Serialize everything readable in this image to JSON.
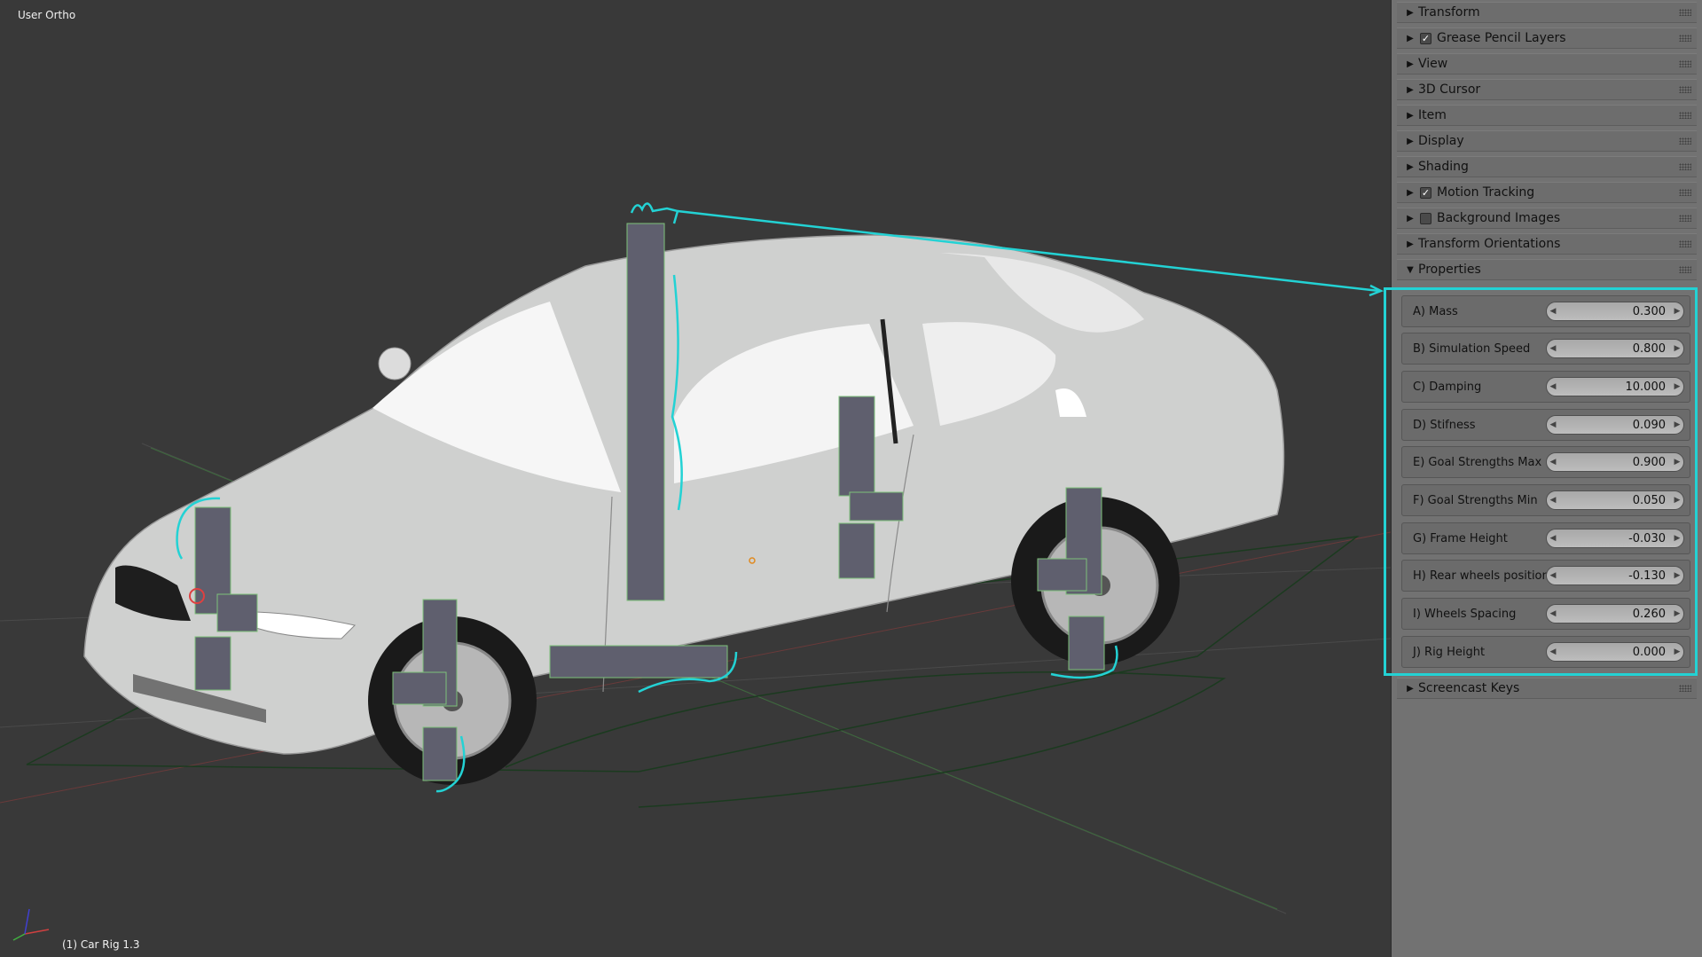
{
  "viewport": {
    "view_label": "User Ortho",
    "object_label": "(1) Car Rig 1.3"
  },
  "sidebar": {
    "panels": [
      {
        "label": "Transform",
        "expanded": false,
        "checkbox": null
      },
      {
        "label": "Grease Pencil Layers",
        "expanded": false,
        "checkbox": true
      },
      {
        "label": "View",
        "expanded": false,
        "checkbox": null
      },
      {
        "label": "3D Cursor",
        "expanded": false,
        "checkbox": null
      },
      {
        "label": "Item",
        "expanded": false,
        "checkbox": null
      },
      {
        "label": "Display",
        "expanded": false,
        "checkbox": null
      },
      {
        "label": "Shading",
        "expanded": false,
        "checkbox": null
      },
      {
        "label": "Motion Tracking",
        "expanded": false,
        "checkbox": true
      },
      {
        "label": "Background Images",
        "expanded": false,
        "checkbox": false
      },
      {
        "label": "Transform Orientations",
        "expanded": false,
        "checkbox": null
      },
      {
        "label": "Properties",
        "expanded": true,
        "checkbox": null
      }
    ],
    "properties": [
      {
        "label": "A) Mass",
        "value": "0.300"
      },
      {
        "label": "B) Simulation Speed",
        "value": "0.800"
      },
      {
        "label": "C) Damping",
        "value": "10.000"
      },
      {
        "label": "D) Stifness",
        "value": "0.090"
      },
      {
        "label": "E) Goal Strengths Max",
        "value": "0.900"
      },
      {
        "label": "F) Goal Strengths Min",
        "value": "0.050"
      },
      {
        "label": "G) Frame Height",
        "value": "-0.030"
      },
      {
        "label": "H) Rear wheels position",
        "value": "-0.130"
      },
      {
        "label": "I) Wheels Spacing",
        "value": "0.260"
      },
      {
        "label": "J) Rig Height",
        "value": "0.000"
      }
    ],
    "footer_panel": {
      "label": "Screencast Keys",
      "expanded": false
    }
  },
  "icons": {
    "expand": "triangle-right-icon",
    "collapse": "triangle-down-icon",
    "grip": "drag-grip-icon"
  },
  "colors": {
    "annotation": "#23d2d4",
    "viewport_bg": "#393939",
    "panel_bg": "#727272"
  }
}
